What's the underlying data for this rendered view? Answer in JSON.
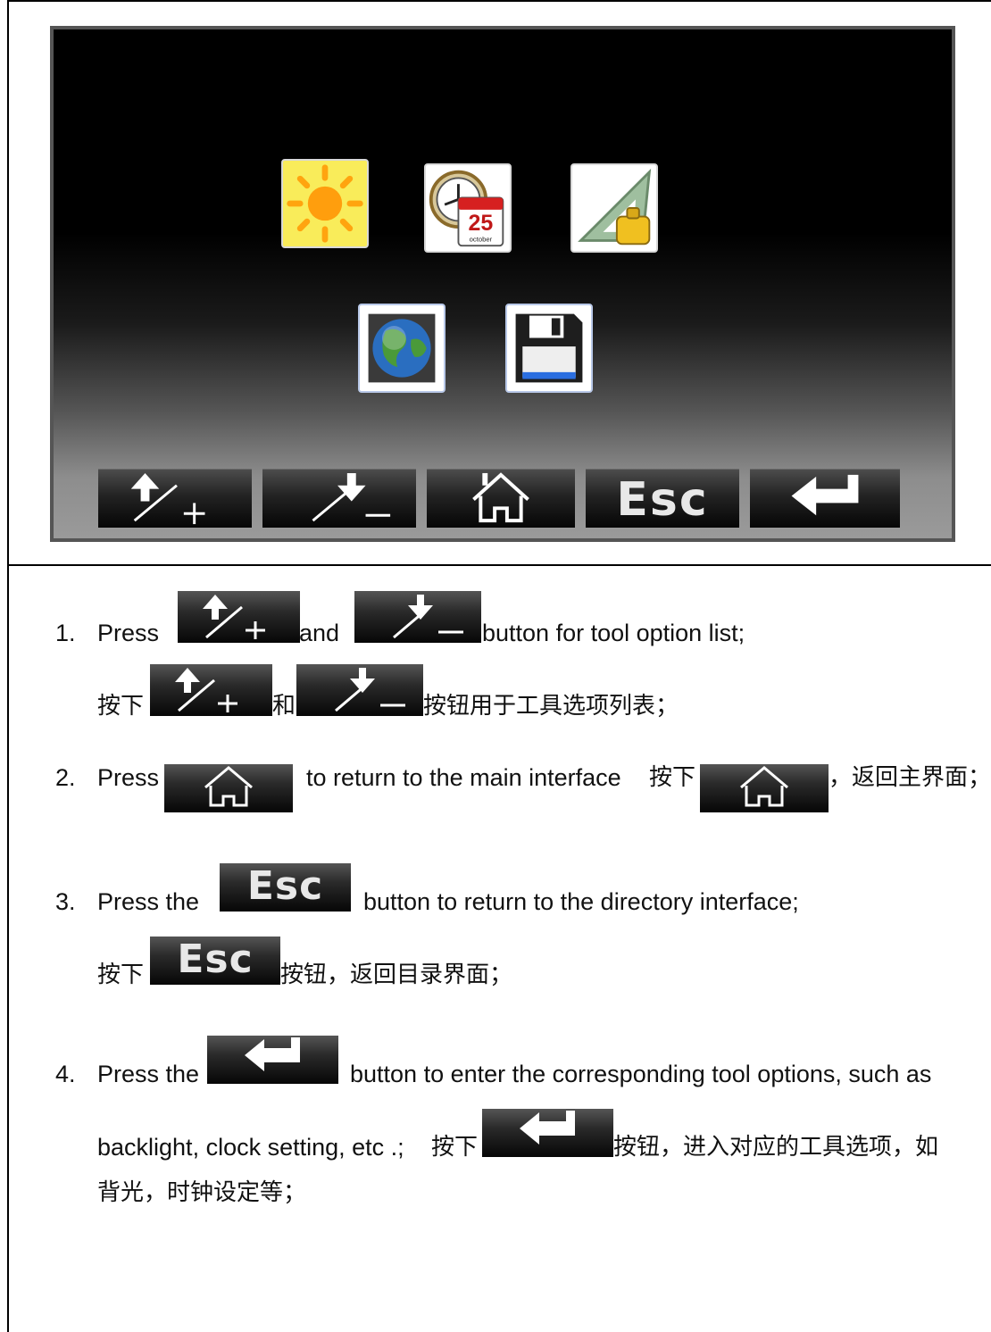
{
  "device_screen": {
    "tools": [
      {
        "name": "backlight",
        "icon": "sun-icon"
      },
      {
        "name": "clock",
        "icon": "clock-calendar-icon",
        "calendar_day": "25",
        "calendar_month": "october"
      },
      {
        "name": "calibration",
        "icon": "triangle-weight-icon"
      },
      {
        "name": "language",
        "icon": "globe-icon"
      },
      {
        "name": "save",
        "icon": "floppy-disk-icon"
      }
    ],
    "softkeys": [
      {
        "id": "up-plus",
        "icon": "up-plus-icon"
      },
      {
        "id": "down-minus",
        "icon": "down-minus-icon"
      },
      {
        "id": "home",
        "icon": "home-icon"
      },
      {
        "id": "esc",
        "label": "Esc"
      },
      {
        "id": "enter",
        "icon": "enter-arrow-icon"
      }
    ]
  },
  "instructions": {
    "item1": {
      "num": "1.",
      "press": "Press",
      "and": "and",
      "rest": "button for tool option list;",
      "cn_press": "按下",
      "cn_and": "和",
      "cn_rest": "按钮用于工具选项列表；"
    },
    "item2": {
      "num": "2.",
      "press": "Press",
      "rest": "to return to the main interface",
      "cn_press": "按下",
      "cn_rest": "，返回主界面；"
    },
    "item3": {
      "num": "3.",
      "press": "Press the",
      "rest": "button to return to the directory interface;",
      "cn_press": "按下",
      "cn_rest": "按钮，返回目录界面；"
    },
    "item4": {
      "num": "4.",
      "press": "Press the",
      "rest": "button to enter the corresponding tool options, such as",
      "line2": "backlight, clock setting, etc .;",
      "cn_press": "按下",
      "cn_rest": "按钮，进入对应的工具选项，如",
      "cn_line3": "背光，时钟设定等；"
    }
  },
  "esc_label": "Esc"
}
